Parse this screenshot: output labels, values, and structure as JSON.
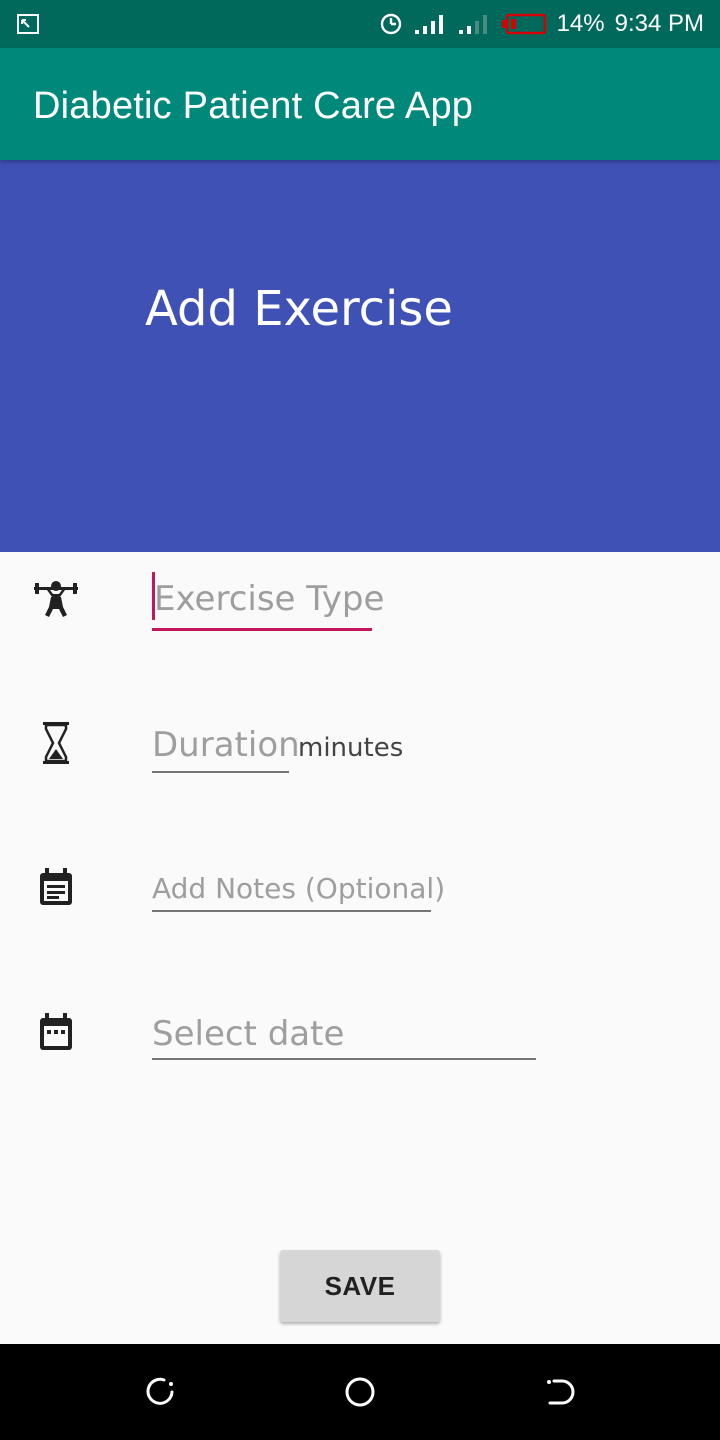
{
  "status_bar": {
    "battery_percent": "14%",
    "time": "9:34 PM",
    "icons": [
      "screen-cast-icon",
      "data-saver-icon",
      "signal-sim1-icon",
      "signal-sim2-icon",
      "battery-low-icon"
    ],
    "battery_color": "#d50000"
  },
  "app_bar": {
    "title": "Diabetic Patient Care App",
    "color": "#00897b"
  },
  "header": {
    "title": "Add Exercise",
    "color": "#3f51b5"
  },
  "form": {
    "exercise_type": {
      "placeholder": "Exercise Type",
      "value": "",
      "icon": "weightlifter-icon"
    },
    "duration": {
      "placeholder": "Duration",
      "suffix": "minutes",
      "icon": "hourglass-icon"
    },
    "notes": {
      "placeholder": "Add Notes (Optional)",
      "icon": "notes-calendar-icon"
    },
    "date": {
      "placeholder": "Select date",
      "icon": "calendar-icon"
    },
    "accent_color": "#c2185b"
  },
  "actions": {
    "save_label": "SAVE"
  },
  "nav_bar": {
    "icons": [
      "recents-icon",
      "home-icon",
      "back-icon"
    ]
  }
}
